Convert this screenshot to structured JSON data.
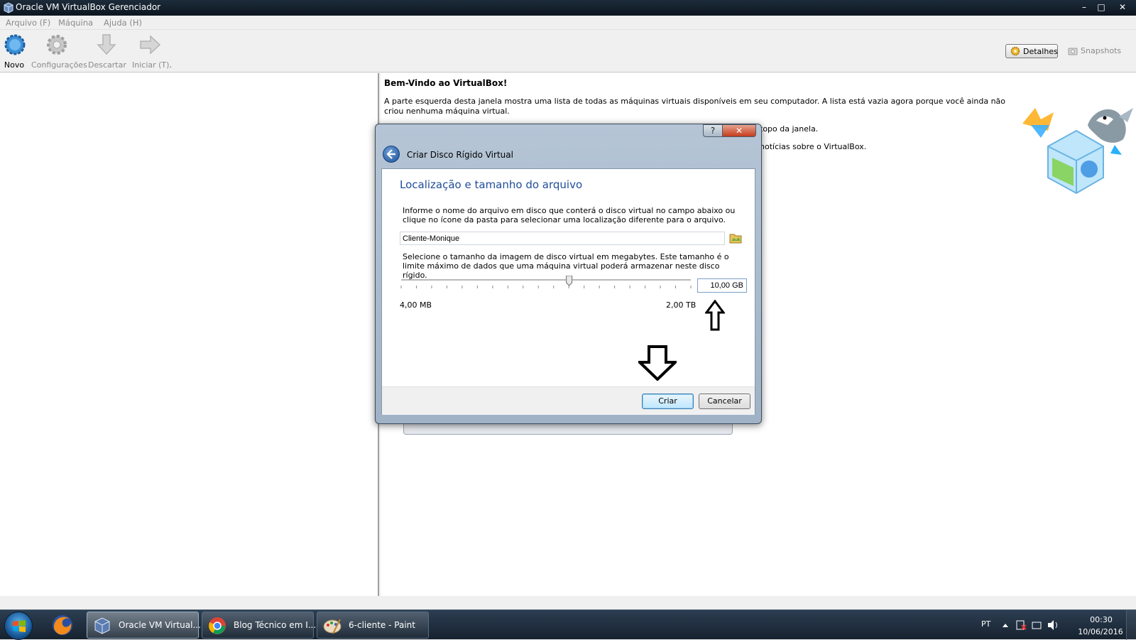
{
  "window": {
    "title": "Oracle VM VirtualBox Gerenciador",
    "controls": {
      "minimize": "–",
      "maximize": "□",
      "close": "✕"
    }
  },
  "menu": [
    "Arquivo (F)",
    "Máquina",
    "Ajuda (H)"
  ],
  "toolbar": {
    "novo": "Novo",
    "configuracoes": "Configurações",
    "descartar": "Descartar",
    "iniciar": "Iniciar (T),",
    "detalhes": "Detalhes",
    "snapshots": "Snapshots"
  },
  "welcome": {
    "title": "Bem-Vindo ao VirtualBox!",
    "p1": "A parte esquerda desta janela mostra uma lista de todas as máquinas virtuais disponíveis em seu computador. A lista está vazia agora porque você ainda não criou nenhuma máquina virtual.",
    "p2_tail": "topo da janela.",
    "p3_tail": "notícias sobre o VirtualBox."
  },
  "dialog": {
    "title": "Criar Disco Rígido Virtual",
    "help": "?",
    "close": "✕",
    "heading": "Localização e tamanho do arquivo",
    "p1": "Informe o nome do arquivo em disco que conterá o disco virtual no campo abaixo ou clique no ícone da pasta para selecionar uma localização diferente para o arquivo.",
    "file_name": "Cliente-Monique",
    "p2": "Selecione o tamanho da imagem de disco virtual em megabytes. Este tamanho é o limite máximo de dados que uma máquina virtual poderá armazenar neste disco rígido.",
    "size_value": "10,00 GB",
    "slider_fraction": 0.58,
    "min_label": "4,00 MB",
    "max_label": "2,00 TB",
    "create": "Criar",
    "cancel": "Cancelar"
  },
  "taskbar": {
    "tasks": [
      "Oracle VM Virtual...",
      "Blog Técnico em I...",
      "6-cliente - Paint"
    ],
    "lang": "PT",
    "time": "00:30",
    "date": "10/06/2016"
  }
}
